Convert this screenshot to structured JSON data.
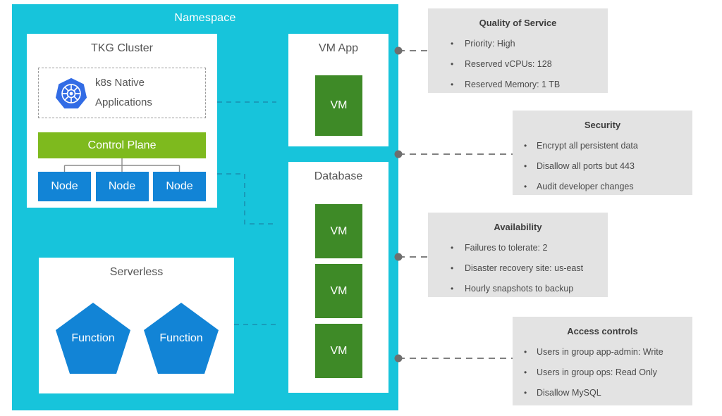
{
  "namespace": {
    "title": "Namespace",
    "color": "#17C4DB"
  },
  "tkg_cluster": {
    "title": "TKG Cluster",
    "k8s_block": {
      "icon": "kubernetes-icon",
      "line1": "k8s Native",
      "line2": "Applications"
    },
    "control_plane": {
      "label": "Control Plane",
      "color": "#7EBA1E"
    },
    "nodes": [
      {
        "label": "Node"
      },
      {
        "label": "Node"
      },
      {
        "label": "Node"
      }
    ],
    "node_color": "#1284D6"
  },
  "serverless": {
    "title": "Serverless",
    "functions": [
      {
        "label": "Function"
      },
      {
        "label": "Function"
      }
    ],
    "color": "#1284D6"
  },
  "vm_app": {
    "title": "VM App",
    "vms": [
      {
        "label": "VM"
      }
    ],
    "color": "#3E8A27"
  },
  "database": {
    "title": "Database",
    "vms": [
      {
        "label": "VM"
      },
      {
        "label": "VM"
      },
      {
        "label": "VM"
      }
    ],
    "color": "#3E8A27"
  },
  "policies": [
    {
      "title": "Quality of Service",
      "items": [
        "Priority: High",
        "Reserved vCPUs: 128",
        "Reserved Memory: 1 TB"
      ]
    },
    {
      "title": "Security",
      "items": [
        "Encrypt all persistent data",
        "Disallow all ports but 443",
        "Audit developer changes"
      ]
    },
    {
      "title": "Availability",
      "items": [
        "Failures to tolerate: 2",
        "Disaster recovery site: us-east",
        "Hourly snapshots to backup"
      ]
    },
    {
      "title": "Access controls",
      "items": [
        "Users in group app-admin: Write",
        "Users in group ops: Read Only",
        "Disallow MySQL"
      ]
    }
  ],
  "style": {
    "panel_background": "#ffffff",
    "info_box_background": "#e3e3e3",
    "connector_color": "#6e6e6e"
  }
}
